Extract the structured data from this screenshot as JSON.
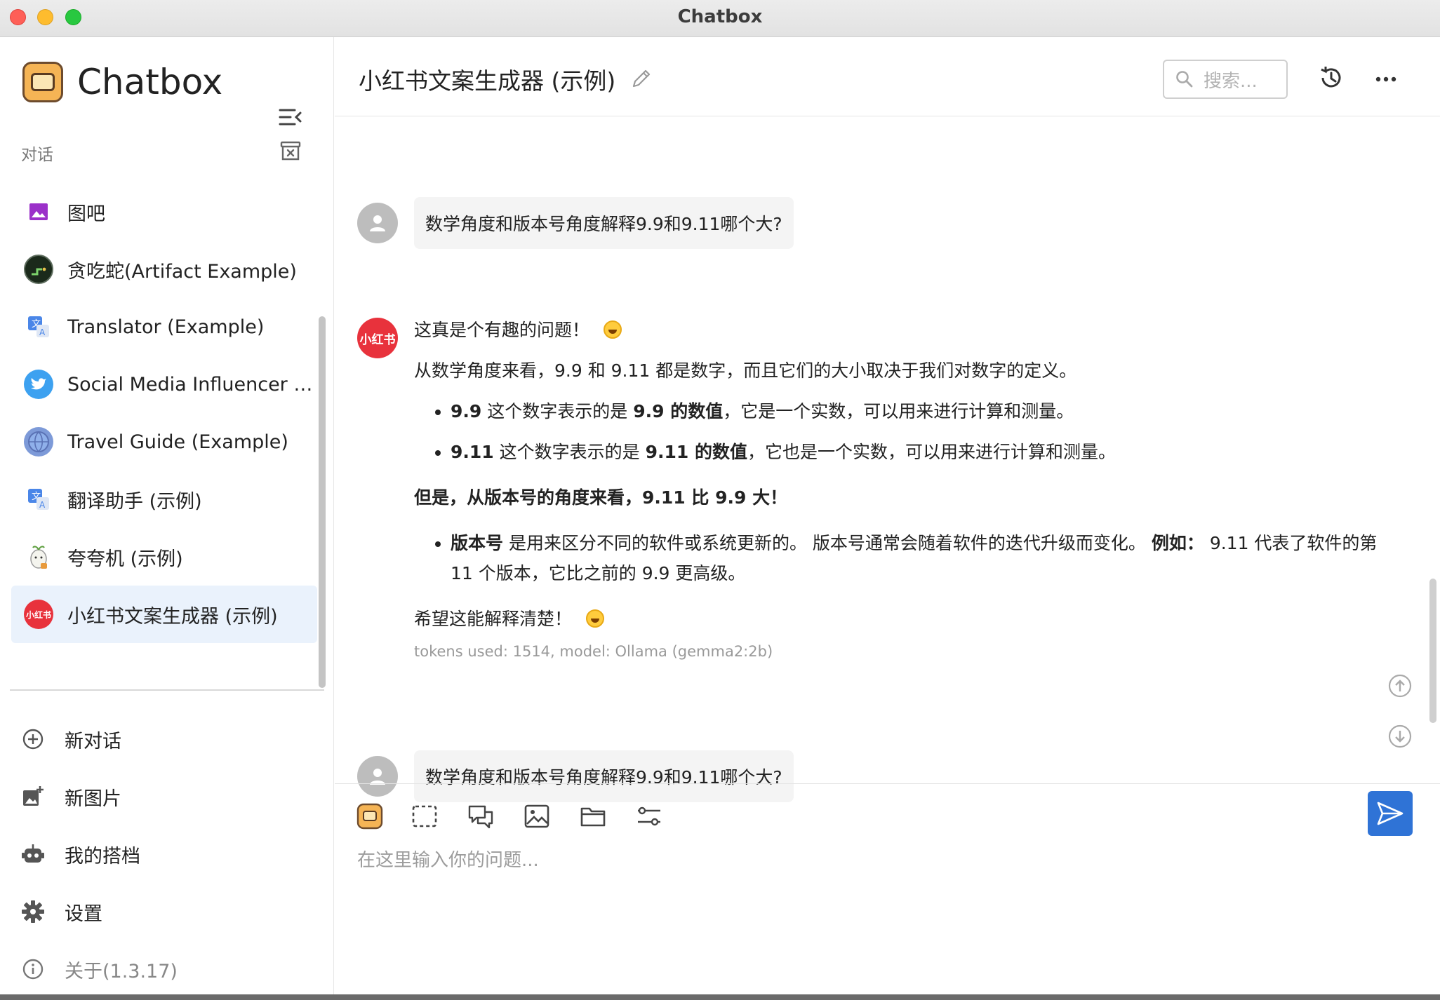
{
  "window": {
    "title": "Chatbox"
  },
  "sidebar": {
    "brand": "Chatbox",
    "section_label": "对话",
    "conversations": [
      {
        "label": "图吧",
        "icon": "image-icon"
      },
      {
        "label": "贪吃蛇(Artifact Example)",
        "icon": "snake-game-icon"
      },
      {
        "label": "Translator (Example)",
        "icon": "translate-icon"
      },
      {
        "label": "Social Media Influencer (Example)",
        "icon": "twitter-bird-icon"
      },
      {
        "label": "Travel Guide (Example)",
        "icon": "globe-icon"
      },
      {
        "label": "翻译助手 (示例)",
        "icon": "translate-icon"
      },
      {
        "label": "夸夸机 (示例)",
        "icon": "sprout-icon"
      },
      {
        "label": "小红书文案生成器 (示例)",
        "icon": "xiaohongshu-icon",
        "active": true
      }
    ],
    "xhs_badge": "小红书",
    "menu": {
      "new_chat": "新对话",
      "new_image": "新图片",
      "my_copilots": "我的搭档",
      "settings": "设置",
      "about": "关于(1.3.17)"
    }
  },
  "header": {
    "chat_title": "小红书文案生成器 (示例)",
    "search_placeholder": "搜索..."
  },
  "messages": {
    "user_1": "数学角度和版本号角度解释9.9和9.11哪个大?",
    "bot_avatar": "小红书",
    "bot": {
      "line1": "这真是个有趣的问题！",
      "line2": "从数学角度来看，9.9 和 9.11 都是数字，而且它们的大小取决于我们对数字的定义。",
      "b1_bold1": "9.9",
      "b1_text1": " 这个数字表示的是 ",
      "b1_bold2": "9.9 的数值",
      "b1_text2": "，它是一个实数，可以用来进行计算和测量。",
      "b2_bold1": "9.11",
      "b2_text1": " 这个数字表示的是 ",
      "b2_bold2": "9.11 的数值",
      "b2_text2": "，它也是一个实数，可以用来进行计算和测量。",
      "heading": "但是，从版本号的角度来看，9.11 比 9.9 大！",
      "b3_bold1": "版本号",
      "b3_text1": " 是用来区分不同的软件或系统更新的。 版本号通常会随着软件的迭代升级而变化。 ",
      "b3_bold2": "例如：",
      "b3_text2": " 9.11 代表了软件的第 11 个版本，它比之前的 9.9 更高级。",
      "closing": "希望这能解释清楚！",
      "meta": "tokens used: 1514, model: Ollama (gemma2:2b)"
    },
    "user_2": "数学角度和版本号角度解释9.9和9.11哪个大?"
  },
  "input": {
    "placeholder": "在这里输入你的问题..."
  },
  "colors": {
    "accent": "#2f73d6",
    "active_item_bg": "#eaf2fc",
    "xiaohongshu_red": "#e8323c"
  }
}
